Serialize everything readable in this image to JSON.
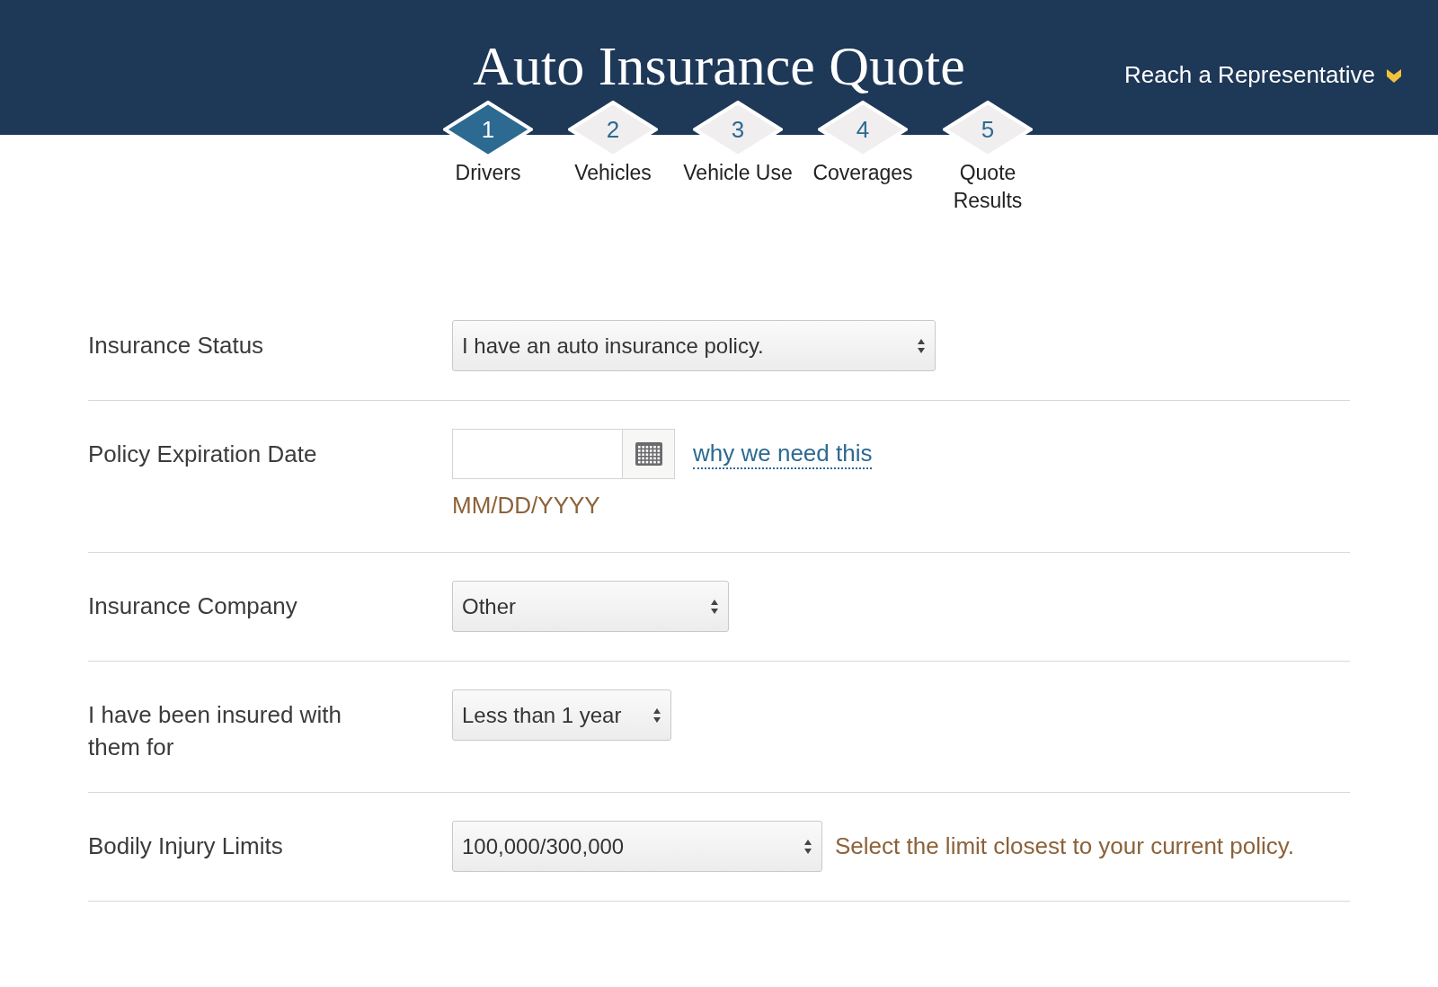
{
  "header": {
    "title": "Auto Insurance Quote",
    "rep_link": "Reach a Representative"
  },
  "steps": [
    {
      "number": "1",
      "label": "Drivers",
      "selected": true
    },
    {
      "number": "2",
      "label": "Vehicles",
      "selected": false
    },
    {
      "number": "3",
      "label": "Vehicle Use",
      "selected": false
    },
    {
      "number": "4",
      "label": "Coverages",
      "selected": false
    },
    {
      "number": "5",
      "label": "Quote Results",
      "selected": false
    }
  ],
  "rows": [
    {
      "kind": "select",
      "label": "Insurance Status",
      "value": "I have an auto insurance policy."
    },
    {
      "kind": "date",
      "label": "Policy Expiration Date",
      "hint": "MM/DD/YYYY",
      "link": "why we need this"
    },
    {
      "kind": "select",
      "label": "Insurance Company",
      "value": "Other"
    },
    {
      "kind": "select",
      "label": "I have been insured with them for",
      "value": "Less than 1 year"
    },
    {
      "kind": "select",
      "label": "Bodily Injury Limits",
      "value": "100,000/300,000",
      "note": "Select the limit closest to your current policy."
    }
  ]
}
